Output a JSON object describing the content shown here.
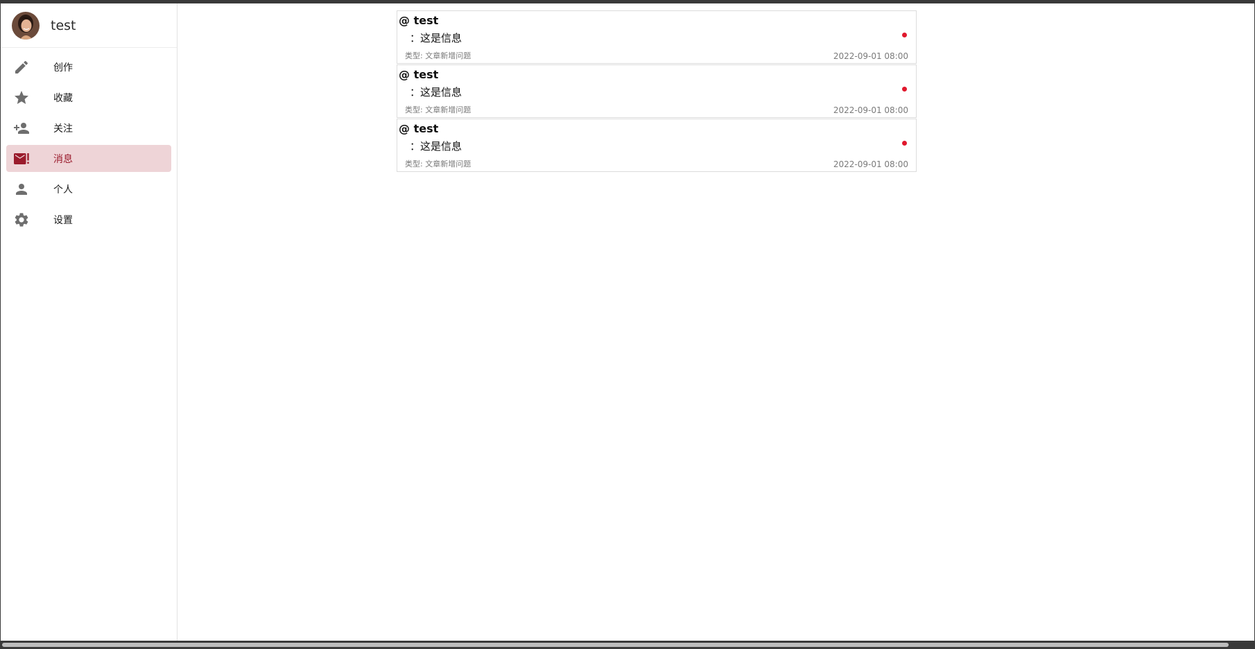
{
  "user": {
    "name": "test"
  },
  "nav": {
    "items": [
      {
        "label": "创作",
        "icon": "pencil-icon"
      },
      {
        "label": "收藏",
        "icon": "star-icon"
      },
      {
        "label": "关注",
        "icon": "person-add-icon"
      },
      {
        "label": "消息",
        "icon": "mail-alert-icon",
        "active": true
      },
      {
        "label": "个人",
        "icon": "person-icon"
      },
      {
        "label": "设置",
        "icon": "gear-icon"
      }
    ]
  },
  "messages": [
    {
      "title": "@ test",
      "body": "：这是信息",
      "type": "类型: 文章新增问题",
      "time": "2022-09-01 08:00",
      "unread": true
    },
    {
      "title": "@ test",
      "body": "：这是信息",
      "type": "类型: 文章新增问题",
      "time": "2022-09-01 08:00",
      "unread": true
    },
    {
      "title": "@ test",
      "body": "：这是信息",
      "type": "类型: 文章新增问题",
      "time": "2022-09-01 08:00",
      "unread": true
    }
  ],
  "colors": {
    "accent": "#9a1b2c",
    "active_bg": "#eed4d7",
    "unread_dot": "#e0182d",
    "icon": "#6e6e6e"
  }
}
